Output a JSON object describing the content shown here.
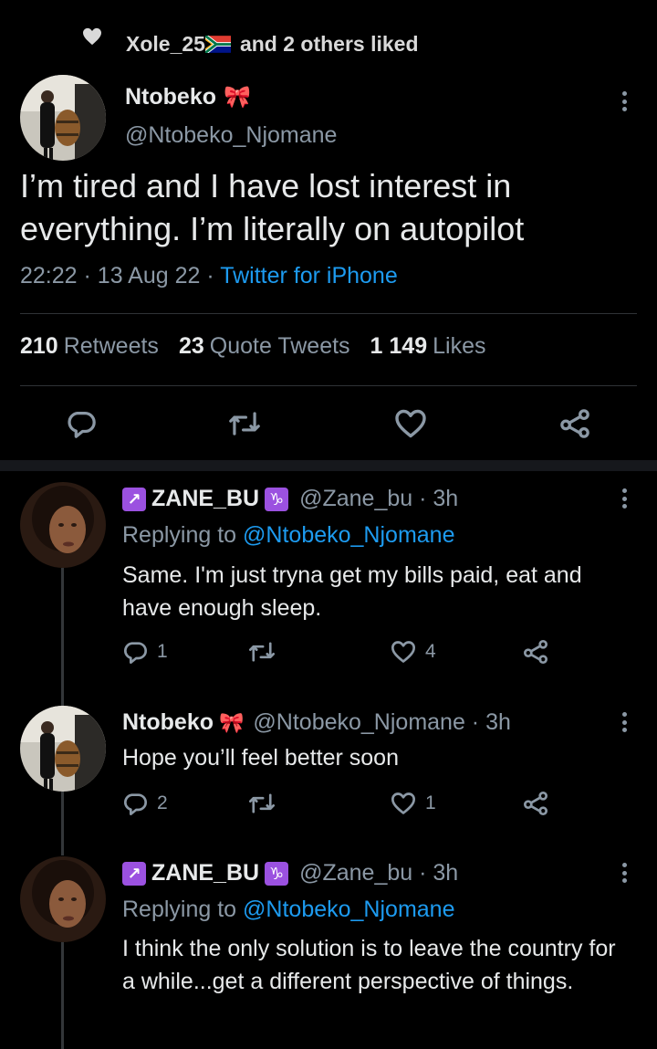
{
  "social_context": {
    "text": "Xole_25",
    "suffix": "and 2 others liked"
  },
  "main_tweet": {
    "name": "Ntobeko",
    "name_emoji": "🎀",
    "handle": "@Ntobeko_Njomane",
    "text": "I’m tired and I have lost interest in everything. I’m literally on autopilot",
    "time": "22:22",
    "date": "13 Aug 22",
    "source": "Twitter for iPhone",
    "sep": "·",
    "stats": {
      "retweets_count": "210",
      "retweets_label": "Retweets",
      "quotes_count": "23",
      "quotes_label": "Quote Tweets",
      "likes_count": "1 149",
      "likes_label": "Likes"
    }
  },
  "replies": [
    {
      "name": "ZANE_BU",
      "name_prefix_glyph": "↗",
      "name_suffix_glyph": "♑",
      "handle_time": "@Zane_bu · 3h",
      "replying_prefix": "Replying to",
      "replying_to": "@Ntobeko_Njomane",
      "text": "Same. I'm just tryna get my bills paid, eat and have enough sleep.",
      "reply_count": "1",
      "retweet_count": "",
      "like_count": "4"
    },
    {
      "name": "Ntobeko",
      "name_emoji": "🎀",
      "handle_time": "@Ntobeko_Njomane · 3h",
      "text": "Hope you’ll feel better soon",
      "reply_count": "2",
      "retweet_count": "",
      "like_count": "1"
    },
    {
      "name": "ZANE_BU",
      "name_prefix_glyph": "↗",
      "name_suffix_glyph": "♑",
      "handle_time": "@Zane_bu · 3h",
      "replying_prefix": "Replying to",
      "replying_to": "@Ntobeko_Njomane",
      "text": "I think the only solution is to leave the country for a while...get a different perspective of things."
    }
  ],
  "colors": {
    "background": "#000000",
    "muted": "#8b98a5",
    "link": "#1d9bf0",
    "divider": "#2f3336"
  }
}
